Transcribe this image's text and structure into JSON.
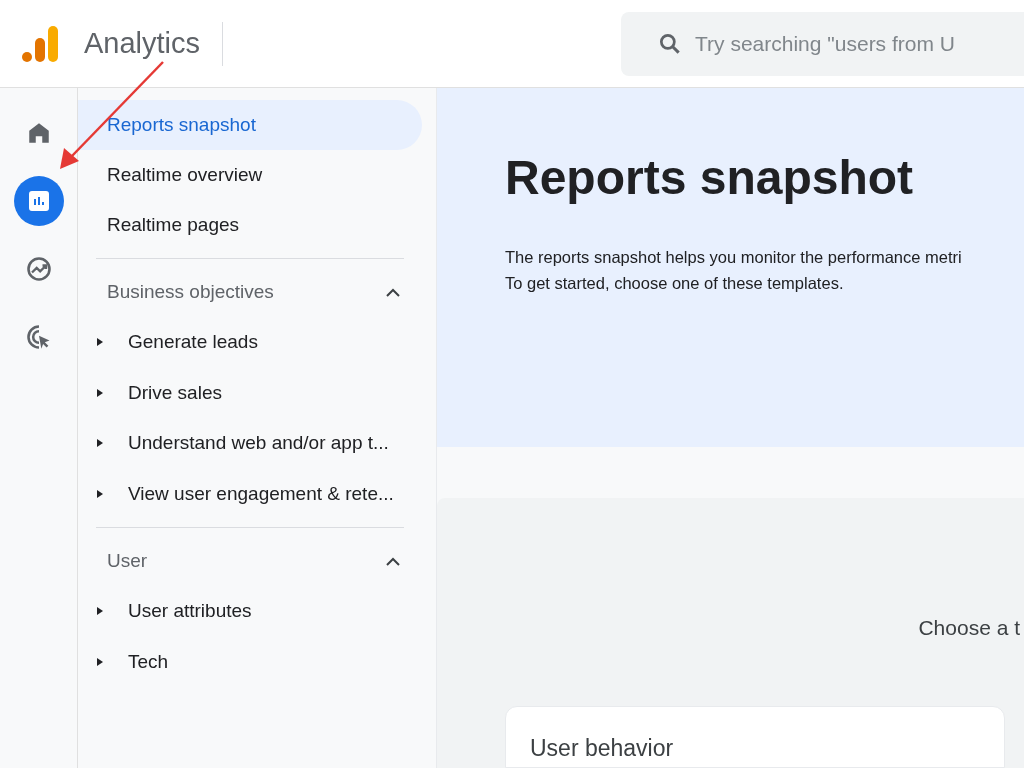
{
  "header": {
    "product": "Analytics",
    "search": {
      "placeholder": "Try searching \"users from U"
    }
  },
  "rail": {
    "items": [
      {
        "kind": "home",
        "selected": false
      },
      {
        "kind": "reports",
        "selected": true
      },
      {
        "kind": "explore",
        "selected": false
      },
      {
        "kind": "advertising",
        "selected": false
      }
    ]
  },
  "nav": {
    "items": [
      {
        "label": "Reports snapshot",
        "selected": true
      },
      {
        "label": "Realtime overview",
        "selected": false
      },
      {
        "label": "Realtime pages",
        "selected": false
      }
    ],
    "sections": [
      {
        "title": "Business objectives",
        "expanded": true,
        "children": [
          {
            "label": "Generate leads",
            "expanded": false
          },
          {
            "label": "Drive sales",
            "expanded": false
          },
          {
            "label": "Understand web and/or app t...",
            "expanded": false
          },
          {
            "label": "View user engagement & rete...",
            "expanded": false
          }
        ]
      },
      {
        "title": "User",
        "expanded": true,
        "children": [
          {
            "label": "User attributes",
            "expanded": false
          },
          {
            "label": "Tech",
            "expanded": false
          }
        ]
      }
    ]
  },
  "main": {
    "title": "Reports snapshot",
    "description": [
      "The reports snapshot helps you monitor the performance metri",
      "To get started, choose one of these templates."
    ],
    "templates": {
      "prompt": "Choose a t",
      "cards": [
        {
          "title": "User behavior"
        }
      ]
    }
  }
}
